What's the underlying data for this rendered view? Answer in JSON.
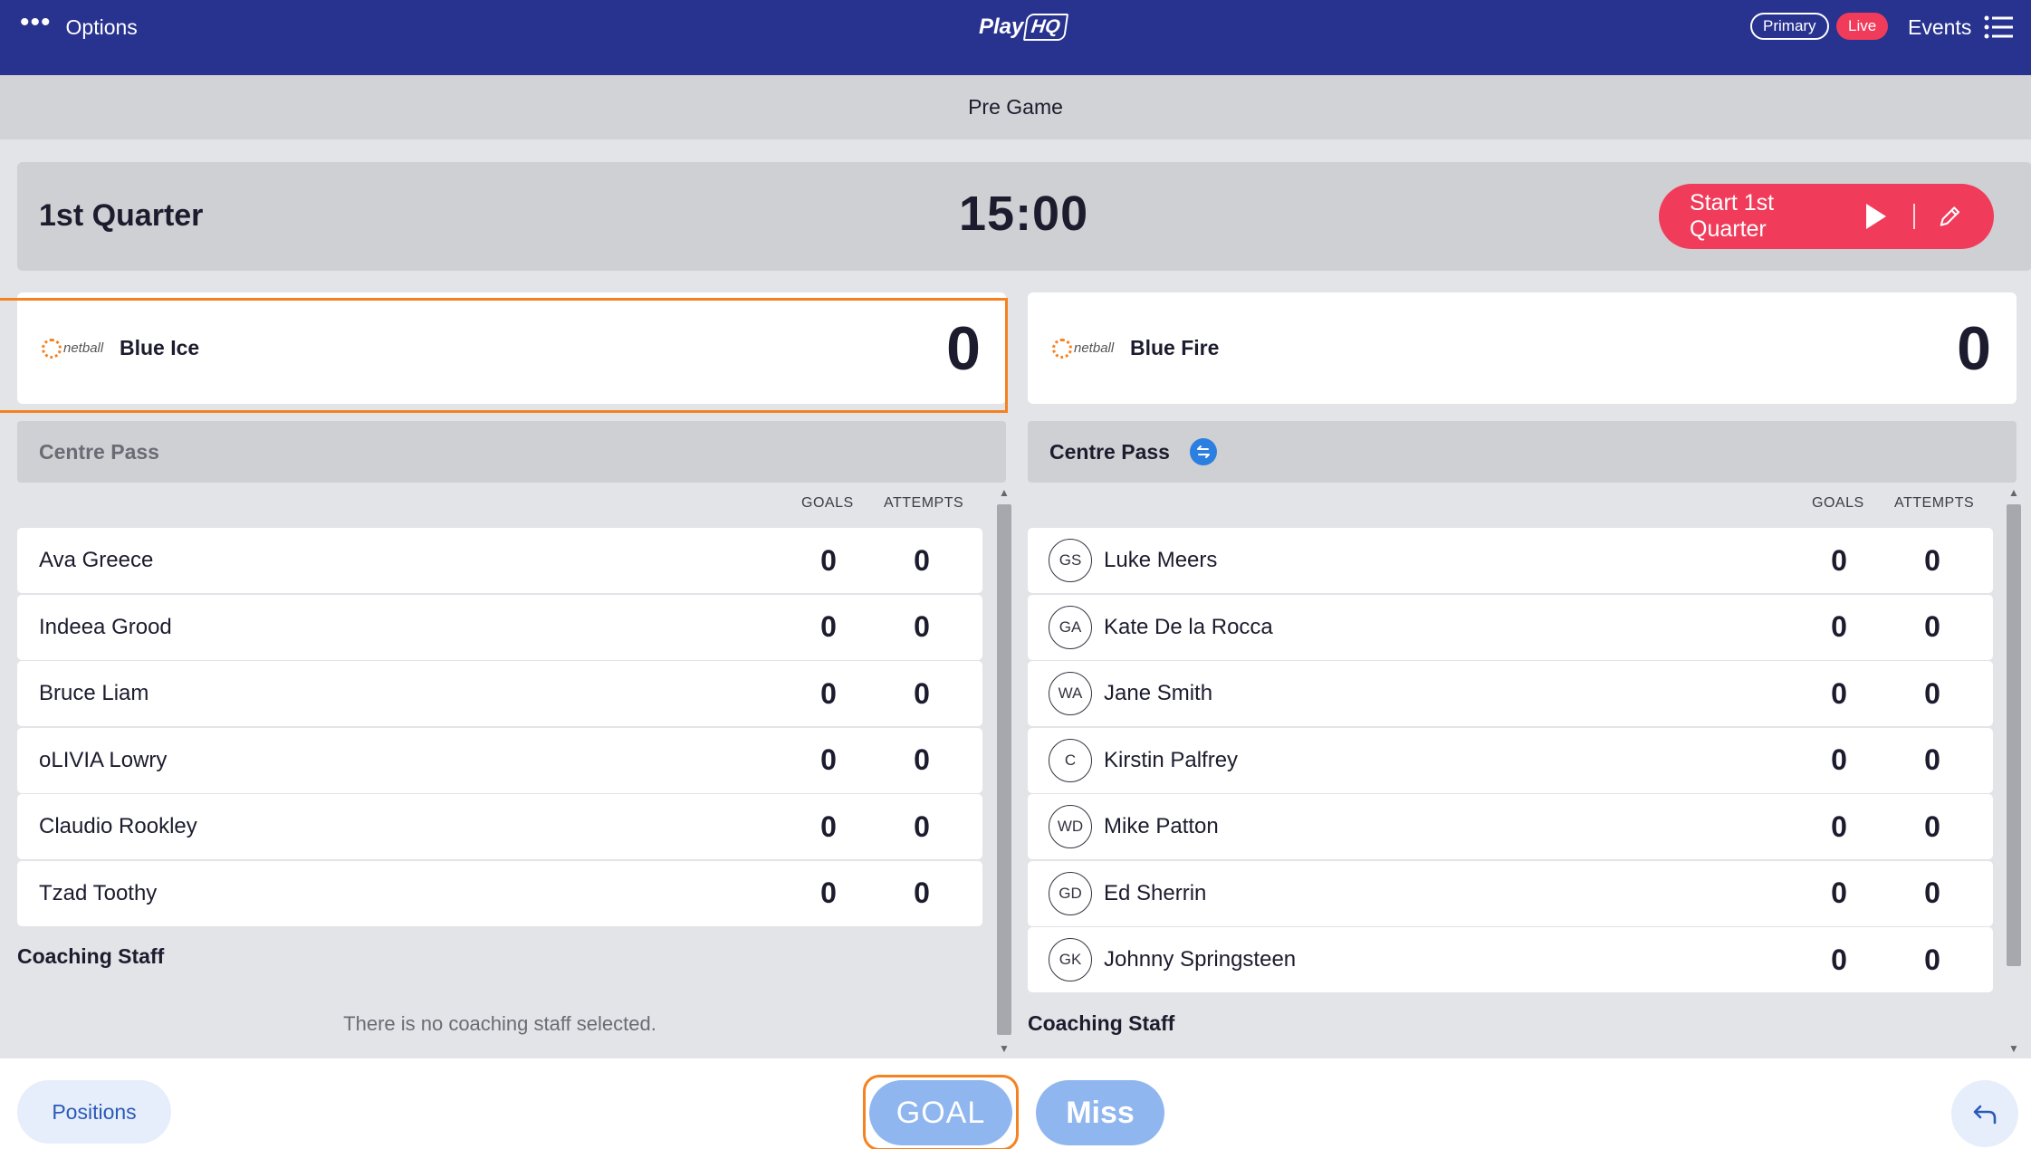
{
  "topbar": {
    "options_label": "Options",
    "logo_text": "Play",
    "logo_badge": "HQ",
    "primary_label": "Primary",
    "live_label": "Live",
    "events_label": "Events"
  },
  "status_bar": {
    "label": "Pre Game"
  },
  "quarter": {
    "label": "1st Quarter",
    "clock": "15:00",
    "start_label": "Start 1st Quarter"
  },
  "teams": {
    "home": {
      "name": "Blue Ice",
      "score": "0",
      "logo_text": "netball"
    },
    "away": {
      "name": "Blue Fire",
      "score": "0",
      "logo_text": "netball"
    }
  },
  "centre_pass": {
    "home_label": "Centre Pass",
    "away_label": "Centre Pass"
  },
  "columns": {
    "goals": "GOALS",
    "attempts": "ATTEMPTS"
  },
  "home_players": [
    {
      "name": "Ava Greece",
      "goals": "0",
      "attempts": "0"
    },
    {
      "name": "Indeea Grood",
      "goals": "0",
      "attempts": "0"
    },
    {
      "name": "Bruce Liam",
      "goals": "0",
      "attempts": "0"
    },
    {
      "name": "oLIVIA Lowry",
      "goals": "0",
      "attempts": "0"
    },
    {
      "name": "Claudio Rookley",
      "goals": "0",
      "attempts": "0"
    },
    {
      "name": "Tzad Toothy",
      "goals": "0",
      "attempts": "0"
    }
  ],
  "away_players": [
    {
      "position": "GS",
      "name": "Luke Meers",
      "goals": "0",
      "attempts": "0"
    },
    {
      "position": "GA",
      "name": "Kate De la Rocca",
      "goals": "0",
      "attempts": "0"
    },
    {
      "position": "WA",
      "name": "Jane Smith",
      "goals": "0",
      "attempts": "0"
    },
    {
      "position": "C",
      "name": "Kirstin Palfrey",
      "goals": "0",
      "attempts": "0"
    },
    {
      "position": "WD",
      "name": "Mike Patton",
      "goals": "0",
      "attempts": "0"
    },
    {
      "position": "GD",
      "name": "Ed Sherrin",
      "goals": "0",
      "attempts": "0"
    },
    {
      "position": "GK",
      "name": "Johnny Springsteen",
      "goals": "0",
      "attempts": "0"
    }
  ],
  "coaching": {
    "home_title": "Coaching Staff",
    "home_empty": "There is no coaching staff selected.",
    "away_title": "Coaching Staff"
  },
  "bottombar": {
    "positions_label": "Positions",
    "goal_label": "GOAL",
    "miss_label": "Miss"
  },
  "colors": {
    "topbar": "#28328f",
    "accent_red": "#f03c5a",
    "highlight_orange": "#f58220",
    "action_blue": "#8fb6ee"
  }
}
